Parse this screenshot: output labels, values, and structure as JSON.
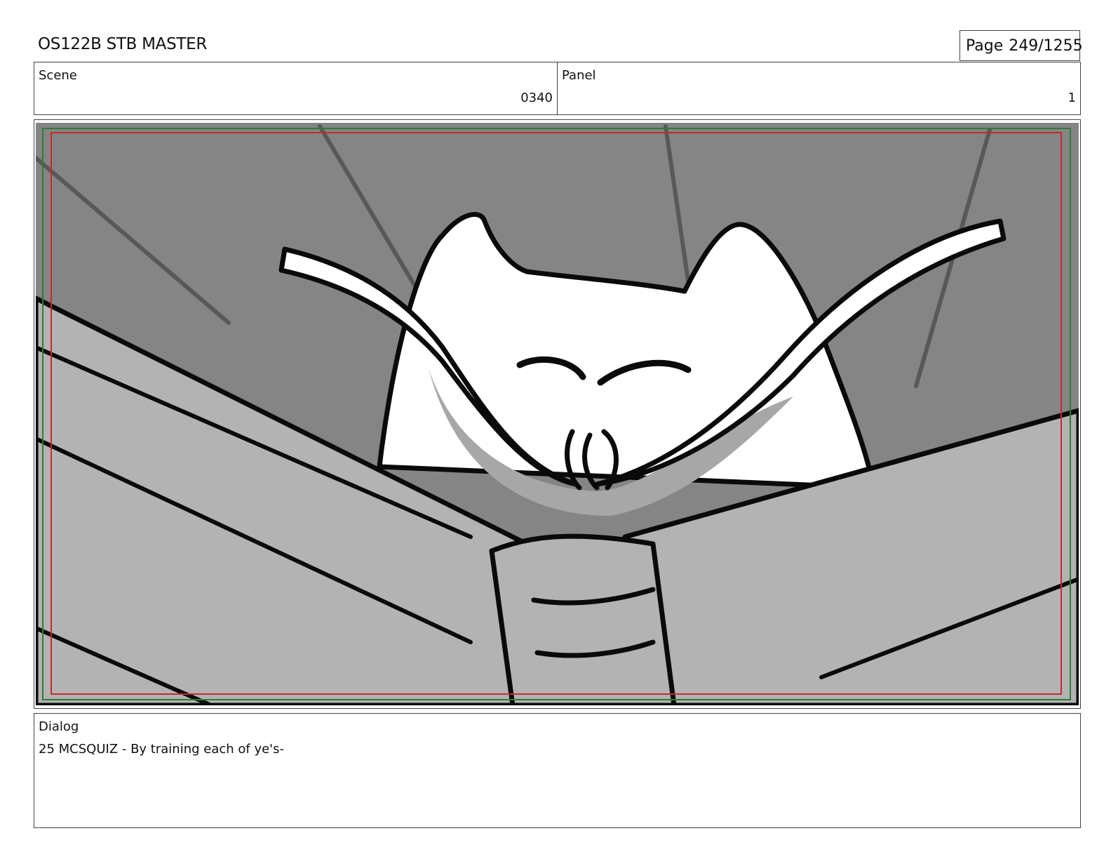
{
  "header": {
    "doc_title": "OS122B STB MASTER",
    "page_label": "Page",
    "page_number": "249/1255"
  },
  "scene": {
    "label": "Scene",
    "value": "0340"
  },
  "panel": {
    "label": "Panel",
    "value": "1"
  },
  "dialog": {
    "label": "Dialog",
    "text": "25 MCSQUIZ - By training each of ye's-"
  },
  "colors": {
    "sky_gray": "#858585",
    "book_gray": "#b3b3b3",
    "ink": "#0a0a0a",
    "safe_red": "#c42b2b",
    "safe_green": "#2f7a3a"
  }
}
